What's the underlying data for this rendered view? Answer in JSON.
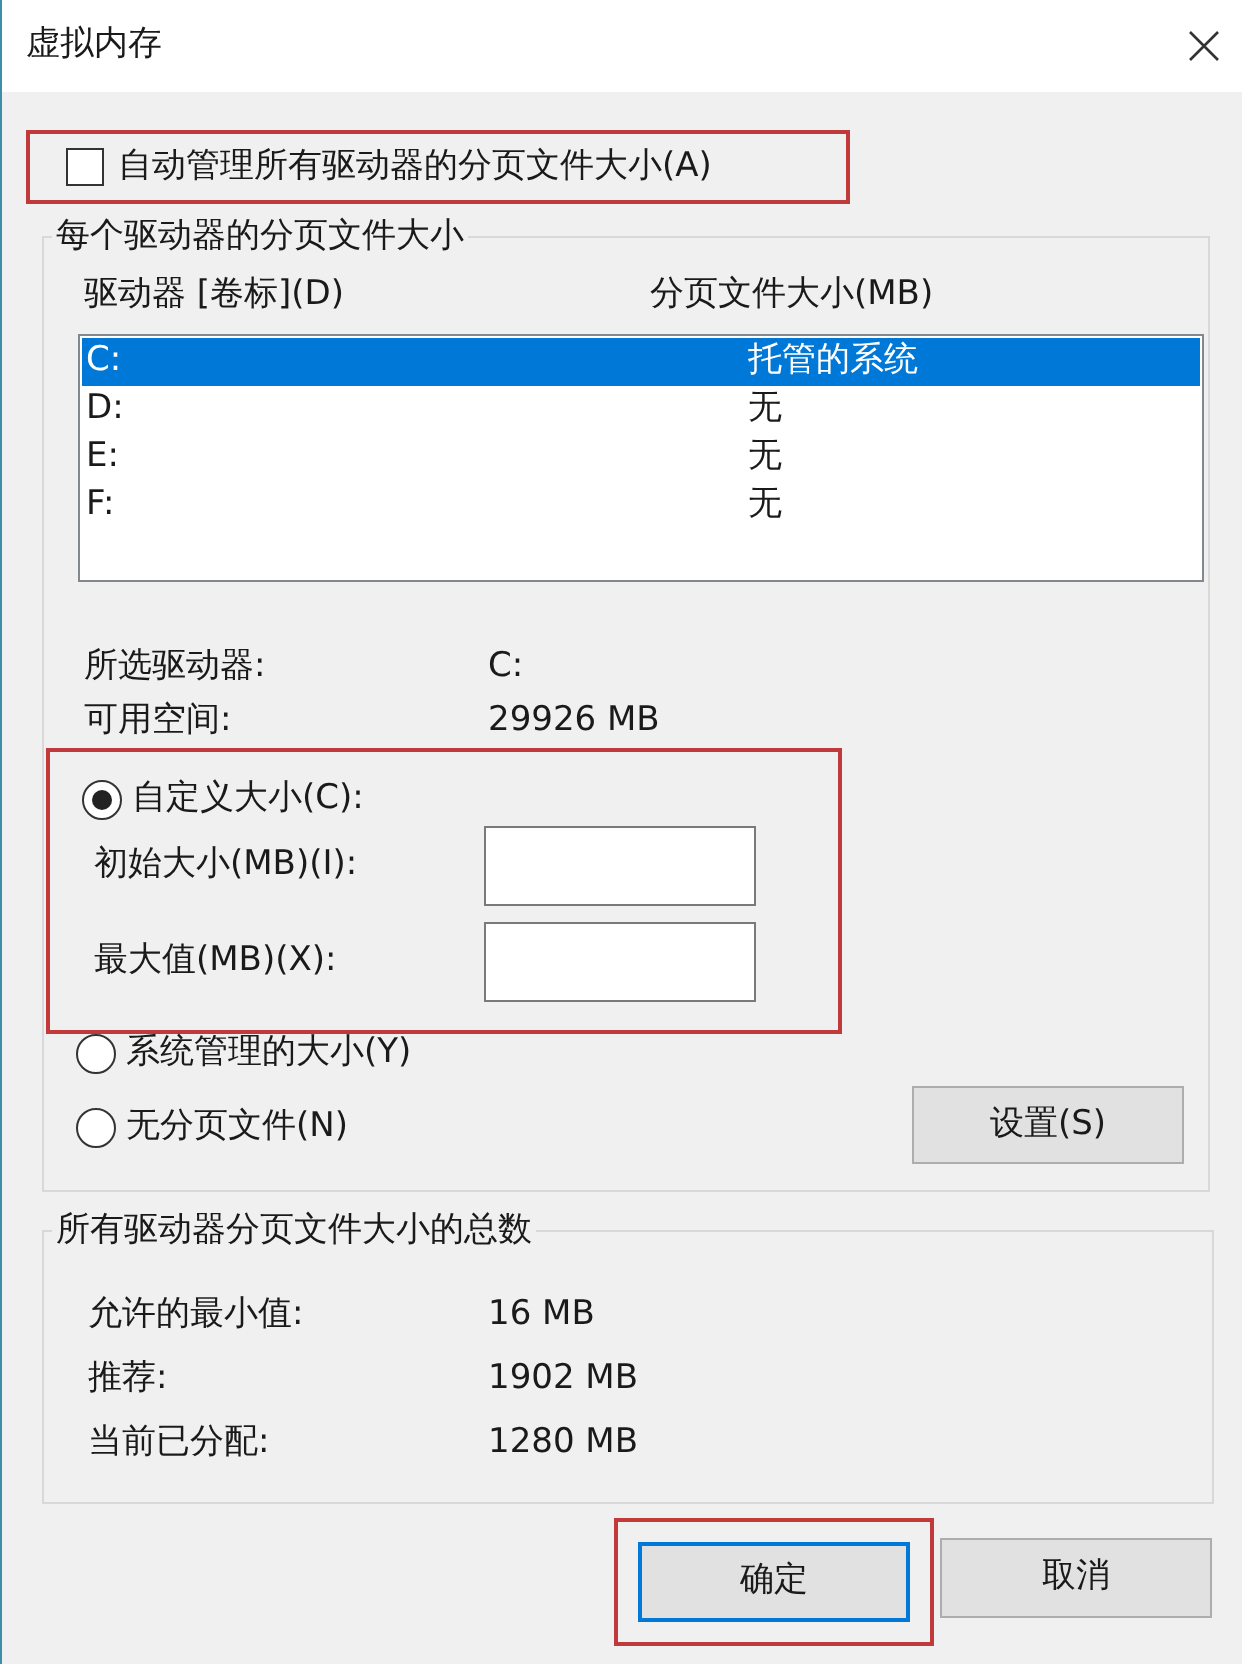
{
  "window": {
    "title": "虚拟内存"
  },
  "auto_manage": {
    "label": "自动管理所有驱动器的分页文件大小(A)",
    "checked": false,
    "highlighted": true
  },
  "per_drive": {
    "title": "每个驱动器的分页文件大小",
    "columns": [
      "驱动器 [卷标](D)",
      "分页文件大小(MB)"
    ],
    "drives": [
      {
        "drive": "C:",
        "size": "托管的系统",
        "selected": true
      },
      {
        "drive": "D:",
        "size": "无",
        "selected": false
      },
      {
        "drive": "E:",
        "size": "无",
        "selected": false
      },
      {
        "drive": "F:",
        "size": "无",
        "selected": false
      }
    ],
    "selected_drive": {
      "label": "所选驱动器:",
      "value": "C:"
    },
    "free_space": {
      "label": "可用空间:",
      "value": "29926 MB"
    },
    "size_options": [
      {
        "kind": "custom",
        "label": "自定义大小(C):",
        "selected": true,
        "highlighted": true,
        "fields": [
          {
            "label": "初始大小(MB)(I):"
          },
          {
            "label": "最大值(MB)(X):"
          }
        ]
      },
      {
        "kind": "plain",
        "label": "系统管理的大小(Y)",
        "selected": false
      },
      {
        "kind": "plain",
        "label": "无分页文件(N)",
        "selected": false
      }
    ],
    "set_button": "设置(S)"
  },
  "totals": {
    "title": "所有驱动器分页文件大小的总数",
    "rows": [
      {
        "label": "允许的最小值:",
        "value": "16 MB"
      },
      {
        "label": "推荐:",
        "value": "1902 MB"
      },
      {
        "label": "当前已分配:",
        "value": "1280 MB"
      }
    ]
  },
  "buttons": [
    {
      "label": "确定",
      "default": true,
      "highlighted": true
    },
    {
      "label": "取消",
      "default": false,
      "highlighted": false
    }
  ]
}
